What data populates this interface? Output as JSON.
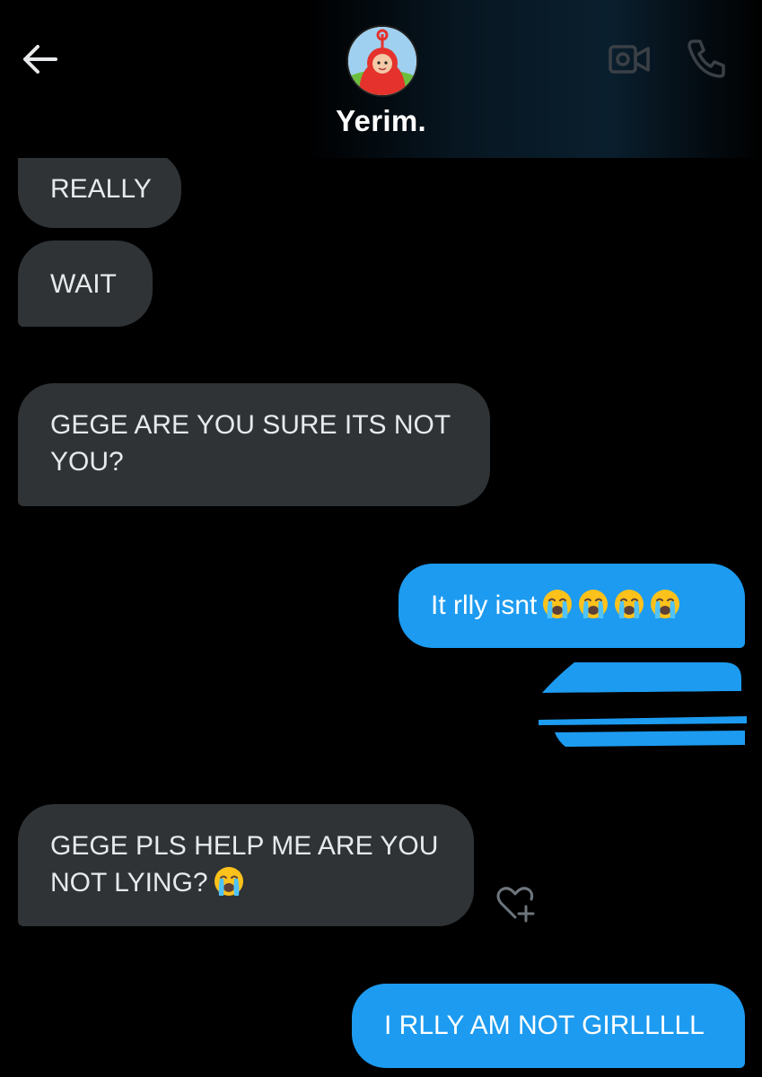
{
  "header": {
    "contact_name": "Yerim.",
    "back_icon": "arrow-left-icon",
    "video_icon": "video-call-icon",
    "call_icon": "phone-icon"
  },
  "messages": [
    {
      "direction": "incoming",
      "text": "REALLY"
    },
    {
      "direction": "incoming",
      "text": "WAIT"
    },
    {
      "direction": "incoming",
      "text": "GEGE ARE YOU SURE ITS NOT YOU?"
    },
    {
      "direction": "outgoing",
      "text": "It rlly isnt",
      "emoji": "loudly-crying-face",
      "emoji_count": 4
    },
    {
      "direction": "outgoing",
      "text": "",
      "redacted": true
    },
    {
      "direction": "incoming",
      "text": "GEGE PLS HELP ME ARE YOU NOT LYING?",
      "emoji": "loudly-crying-face",
      "emoji_count": 1
    },
    {
      "direction": "outgoing",
      "text": "I RLLY AM NOT GIRLLLLL"
    }
  ],
  "react_icon": "heart-plus-icon",
  "colors": {
    "incoming_bubble": "#2f3336",
    "outgoing_bubble": "#1d9bf0",
    "background": "#000000"
  }
}
